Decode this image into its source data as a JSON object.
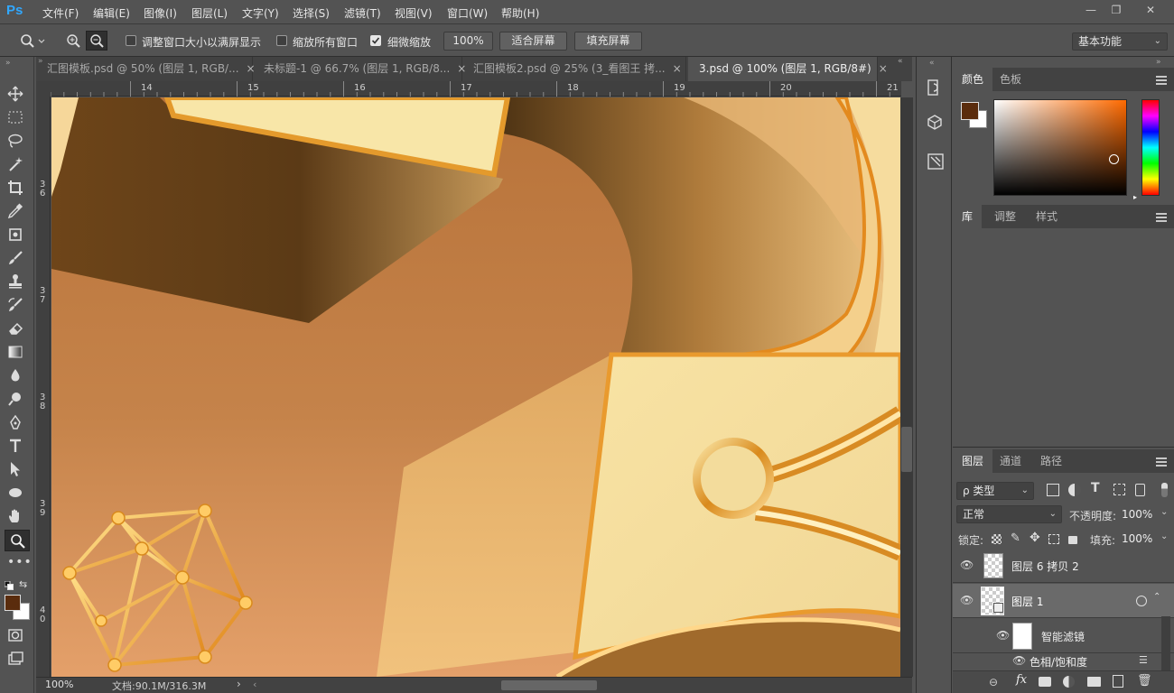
{
  "app": {
    "logo": "Ps"
  },
  "menu": [
    "文件(F)",
    "编辑(E)",
    "图像(I)",
    "图层(L)",
    "文字(Y)",
    "选择(S)",
    "滤镜(T)",
    "视图(V)",
    "窗口(W)",
    "帮助(H)"
  ],
  "window_controls": {
    "minimize": "—",
    "restore": "❐",
    "close": "✕"
  },
  "options": {
    "resize_windows_label": "调整窗口大小以满屏显示",
    "resize_windows_checked": false,
    "zoom_all_label": "缩放所有窗口",
    "zoom_all_checked": false,
    "scrubby_label": "细微缩放",
    "scrubby_checked": true,
    "zoom_value": "100%",
    "fit_screen": "适合屏幕",
    "fill_screen": "填充屏幕",
    "workspace": "基本功能"
  },
  "tabs": [
    {
      "label": "汇图模板.psd @ 50% (图层 1, RGB/...",
      "close": "×",
      "active": false
    },
    {
      "label": "未标题-1 @ 66.7% (图层 1, RGB/8...",
      "close": "×",
      "active": false
    },
    {
      "label": "汇图模板2.psd @ 25% (3_看图王 拷...",
      "close": "×",
      "active": false
    },
    {
      "label": "3.psd @ 100% (图层 1, RGB/8#)",
      "close": "×",
      "active": true
    }
  ],
  "ruler": {
    "h_ticks": [
      "14",
      "15",
      "16",
      "17",
      "18",
      "19",
      "20",
      "21"
    ],
    "v_ticks": [
      "3",
      "6",
      "3",
      "7",
      "3",
      "8",
      "3",
      "9",
      "4",
      "0"
    ]
  },
  "status": {
    "zoom": "100%",
    "doc": "文档:90.1M/316.3M",
    "arrow": "›"
  },
  "color_panel": {
    "tabs": [
      "颜色",
      "色板"
    ],
    "fg_color": "#5a2c0d",
    "bg_color": "#ffffff"
  },
  "library_panel": {
    "tabs": [
      "库",
      "调整",
      "样式"
    ]
  },
  "layers_panel": {
    "tabs": [
      "图层",
      "通道",
      "路径"
    ],
    "filter_label": "ρ 类型",
    "blend_mode": "正常",
    "opacity_label": "不透明度:",
    "opacity_value": "100%",
    "lock_label": "锁定:",
    "fill_label": "填充:",
    "fill_value": "100%",
    "layers": [
      {
        "name": "图层 6 拷贝 2"
      },
      {
        "name": "图层 1"
      },
      {
        "name": "智能滤镜"
      },
      {
        "name": "色相/饱和度"
      }
    ],
    "footer_icons": [
      "link-icon",
      "fx-icon",
      "mask-icon",
      "adjustment-icon",
      "folder-icon",
      "new-layer-icon",
      "trash-icon"
    ],
    "fx_label": "fx"
  },
  "colors": {
    "accent": "#31a8ff",
    "gold": "#f3d48c",
    "canvas_base": "#c07a3e"
  }
}
